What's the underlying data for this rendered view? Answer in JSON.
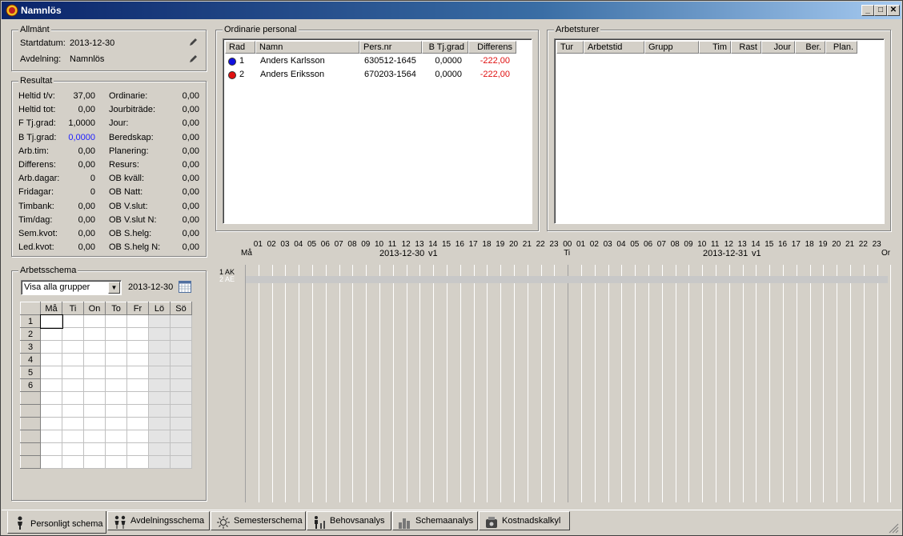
{
  "window": {
    "title": "Namnlös"
  },
  "allmant": {
    "legend": "Allmänt",
    "startdatum_label": "Startdatum:",
    "startdatum": "2013-12-30",
    "avdelning_label": "Avdelning:",
    "avdelning": "Namnlös"
  },
  "resultat": {
    "legend": "Resultat",
    "left": [
      {
        "label": "Heltid t/v:",
        "value": "37,00"
      },
      {
        "label": "Heltid tot:",
        "value": "0,00"
      },
      {
        "label": "F Tj.grad:",
        "value": "1,0000"
      },
      {
        "label": "B Tj.grad:",
        "value": "0,0000"
      },
      {
        "label": "Arb.tim:",
        "value": "0,00"
      },
      {
        "label": "Differens:",
        "value": "0,00"
      },
      {
        "label": "Arb.dagar:",
        "value": "0"
      },
      {
        "label": "Fridagar:",
        "value": "0"
      },
      {
        "label": "Timbank:",
        "value": "0,00"
      },
      {
        "label": "Tim/dag:",
        "value": "0,00"
      },
      {
        "label": "Sem.kvot:",
        "value": "0,00"
      },
      {
        "label": "Led.kvot:",
        "value": "0,00"
      }
    ],
    "right": [
      {
        "label": "Ordinarie:",
        "value": "0,00"
      },
      {
        "label": "Jourbiträde:",
        "value": "0,00"
      },
      {
        "label": "Jour:",
        "value": "0,00"
      },
      {
        "label": "Beredskap:",
        "value": "0,00"
      },
      {
        "label": "Planering:",
        "value": "0,00"
      },
      {
        "label": "Resurs:",
        "value": "0,00"
      },
      {
        "label": "OB kväll:",
        "value": "0,00"
      },
      {
        "label": "OB Natt:",
        "value": "0,00"
      },
      {
        "label": "OB V.slut:",
        "value": "0,00"
      },
      {
        "label": "OB V.slut N:",
        "value": "0,00"
      },
      {
        "label": "OB S.helg:",
        "value": "0,00"
      },
      {
        "label": "OB S.helg N:",
        "value": "0,00"
      }
    ]
  },
  "arbetsschema": {
    "legend": "Arbetsschema",
    "group_select": "Visa alla grupper",
    "date": "2013-12-30",
    "days": [
      "Må",
      "Ti",
      "On",
      "To",
      "Fr",
      "Lö",
      "Sö"
    ],
    "rows": [
      "1",
      "2",
      "3",
      "4",
      "5",
      "6",
      "",
      "",
      "",
      "",
      "",
      ""
    ]
  },
  "ordinarie": {
    "legend": "Ordinarie personal",
    "columns": [
      "Rad",
      "Namn",
      "Pers.nr",
      "B Tj.grad",
      "Differens"
    ],
    "rows": [
      {
        "rad": "1",
        "namn": "Anders Karlsson",
        "persnr": "630512-1645",
        "btj": "0,0000",
        "diff": "-222,00",
        "color": "#1010e0"
      },
      {
        "rad": "2",
        "namn": "Anders Eriksson",
        "persnr": "670203-1564",
        "btj": "0,0000",
        "diff": "-222,00",
        "color": "#e01010"
      }
    ]
  },
  "arbetsturer": {
    "legend": "Arbetsturer",
    "columns": [
      "Tur",
      "Arbetstid",
      "Grupp",
      "Tim",
      "Rast",
      "Jour",
      "Ber.",
      "Plan."
    ]
  },
  "timeline": {
    "hours1": [
      "01",
      "02",
      "03",
      "04",
      "05",
      "06",
      "07",
      "08",
      "09",
      "10",
      "11",
      "12",
      "13",
      "14",
      "15",
      "16",
      "17",
      "18",
      "19",
      "20",
      "21",
      "22",
      "23"
    ],
    "day1": "Må",
    "date1": "2013-12-30",
    "week1": "v1",
    "mid": "00",
    "day2": "Ti",
    "hours2": [
      "01",
      "02",
      "03",
      "04",
      "05",
      "06",
      "07",
      "08",
      "09",
      "10",
      "11",
      "12",
      "13",
      "14",
      "15",
      "16",
      "17",
      "18",
      "19",
      "20",
      "21",
      "22",
      "23"
    ],
    "date2": "2013-12-31",
    "week2": "v1",
    "end": "Or",
    "row_labels": [
      "1 AK",
      "2 AE"
    ]
  },
  "tabs": [
    "Personligt schema",
    "Avdelningsschema",
    "Semesterschema",
    "Behovsanalys",
    "Schemaanalys",
    "Kostnadskalkyl"
  ],
  "colors": {
    "accent": "#0a246a",
    "negative": "#e01010",
    "link_value": "#2020ff"
  }
}
